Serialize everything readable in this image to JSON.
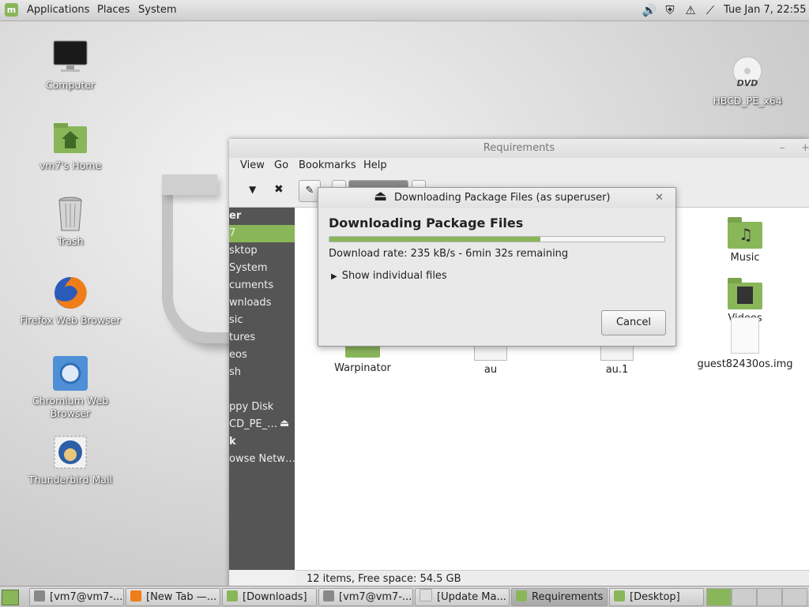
{
  "top_panel": {
    "menus": [
      "Applications",
      "Places",
      "System"
    ],
    "clock": "Tue Jan  7, 22:55"
  },
  "desktop": {
    "icons": [
      {
        "label": "Computer"
      },
      {
        "label": "vm7's Home"
      },
      {
        "label": "Trash"
      },
      {
        "label": "Firefox Web Browser"
      },
      {
        "label": "Chromium Web Browser"
      },
      {
        "label": "Thunderbird Mail"
      },
      {
        "label": "HBCD_PE_x64",
        "badge": "DVD"
      }
    ]
  },
  "file_manager": {
    "title": "Requirements",
    "menus": [
      "View",
      "Go",
      "Bookmarks",
      "Help"
    ],
    "sidebar": [
      {
        "label": "er",
        "heading": true
      },
      {
        "label": "7",
        "selected": true
      },
      {
        "label": "sktop"
      },
      {
        "label": " System"
      },
      {
        "label": "cuments"
      },
      {
        "label": "wnloads"
      },
      {
        "label": "sic"
      },
      {
        "label": "tures"
      },
      {
        "label": "eos"
      },
      {
        "label": "sh"
      },
      {
        "label": ""
      },
      {
        "label": "ppy Disk"
      },
      {
        "label": "CD_PE_…"
      },
      {
        "label": "k",
        "heading": true
      },
      {
        "label": "owse Netw…"
      }
    ],
    "files": [
      {
        "name": "Music",
        "kind": "folder-music"
      },
      {
        "name": "Videos",
        "kind": "folder-video"
      },
      {
        "name": "Warpinator",
        "kind": "folder"
      },
      {
        "name": "au",
        "kind": "text",
        "thumb": "ABC"
      },
      {
        "name": "au.1",
        "kind": "text",
        "thumb": "ABC"
      },
      {
        "name": "guest82430os.img",
        "kind": "file"
      }
    ],
    "status": "12 items, Free space: 54.5 GB"
  },
  "dialog": {
    "title": "Downloading Package Files (as superuser)",
    "heading": "Downloading Package Files",
    "progress": 0.63,
    "rate_text": "Download rate: 235 kB/s - 6min 32s remaining",
    "expander_label": "Show individual files",
    "cancel_label": "Cancel"
  },
  "taskbar": {
    "tasks": [
      {
        "label": "[vm7@vm7-..."
      },
      {
        "label": "[New Tab —..."
      },
      {
        "label": "[Downloads]"
      },
      {
        "label": "[vm7@vm7-..."
      },
      {
        "label": "[Update Ma..."
      },
      {
        "label": "Requirements",
        "active": true
      },
      {
        "label": "[Desktop]"
      }
    ]
  },
  "colors": {
    "accent": "#8ab65a",
    "sidebar_bg": "#555555"
  }
}
